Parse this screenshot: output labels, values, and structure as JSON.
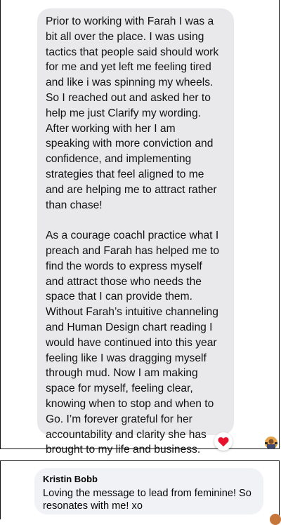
{
  "testimonial": {
    "paragraphs": [
      "Prior to working with Farah I was a\nbit all over the place. I was using\ntactics that people said should work\nfor me and yet left me feeling tired\nand like i was spinning my wheels.\nSo I reached out and asked her to\nhelp me just Clarify my wording.\nAfter working with her I am\nspeaking with more conviction and\nconfidence, and implementing\nstrategies that feel aligned to me\nand are helping me to attract rather\nthan chase!",
      "As a courage coachl practice what I\npreach and Farah has helped me to\nfind the words to express myself\nand attract those who needs the\nspace that I can provide them.\nWithout Farah’s intuitive channeling\nand Human Design chart reading I\nwould have continued into this year\nfeeling like I was dragging myself\nthrough mud. Now I am making\nspace for myself, feeling clear,\nknowing when to stop and when to\nGo. I’m forever grateful for her\naccountability and clarity she has\nbrought to my life and business."
    ],
    "reaction_icon": "heart-icon",
    "reaction_color": "#e8112d"
  },
  "comment": {
    "author": "Kristin Bobb",
    "text": "Loving the message to lead from feminine! So\nresonates with me! xo"
  }
}
